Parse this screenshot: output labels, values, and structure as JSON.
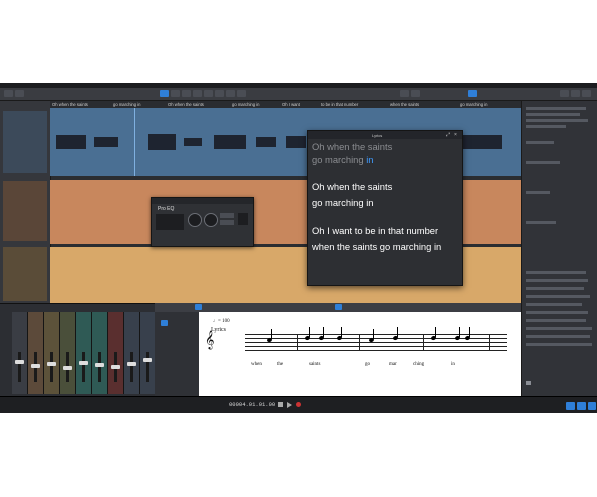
{
  "app": {
    "title": "Studio One - Saints"
  },
  "lyrics_track": {
    "items": [
      "Oh when the saints",
      "go marching in",
      "Oh when the saints",
      "go marching in",
      "Oh I want",
      "to be in that number",
      "when the saints",
      "go marching in"
    ]
  },
  "lyrics_panel": {
    "title": "Lyrics",
    "lines": [
      {
        "text": "Oh when the saints",
        "style": "dim"
      },
      {
        "text_before": "go marching ",
        "highlight": "in",
        "style": "dim"
      },
      {
        "text": "Oh when the saints",
        "style": "bright"
      },
      {
        "text": "go marching in",
        "style": "bright"
      },
      {
        "text": "Oh I want to be in that number",
        "style": "bright"
      },
      {
        "text": "when the saints go marching in",
        "style": "bright"
      }
    ]
  },
  "plugin": {
    "name": "Pro EQ",
    "label": "On"
  },
  "score": {
    "tempo": "♩= 100",
    "track_label": "Lyrics",
    "syllables": [
      "when",
      "the",
      "saints",
      "go",
      "mar",
      "ching",
      "in"
    ]
  },
  "transport": {
    "time": "00004.01.01.00"
  },
  "colors": {
    "accent": "#2f7fd8",
    "track1": "#4a6f93",
    "track2": "#c8875d",
    "track3": "#d8a869",
    "lyric_highlight": "#3f9bff"
  }
}
